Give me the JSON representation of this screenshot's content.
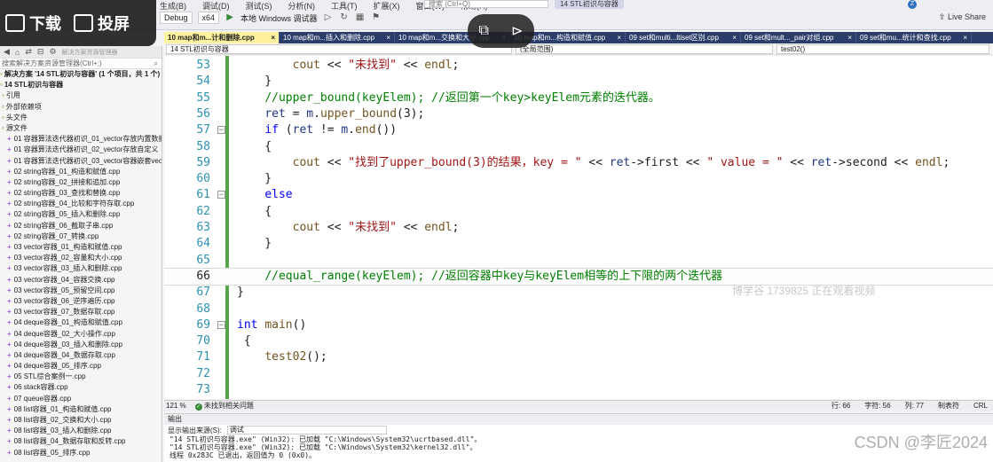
{
  "overlay": {
    "download_label": "下载",
    "share_label": "投屏"
  },
  "menu": {
    "items": [
      "生成(B)",
      "调试(D)",
      "测试(S)",
      "分析(N)",
      "工具(T)",
      "扩展(X)",
      "窗口(W)",
      "帮助(H)"
    ],
    "search_placeholder": "搜索 (Ctrl+Q)",
    "window_title": "14 STL初识与容器",
    "live_share": "Live Share",
    "user_initial": "Z"
  },
  "toolbar": {
    "config": "Debug",
    "platform": "x64",
    "run_label": "本地 Windows 调试器"
  },
  "solution_explorer": {
    "toolbar_label": "解决方案资源管理器",
    "search_placeholder": "搜索解决方案资源管理器(Ctrl+;)",
    "items": [
      {
        "text": "解决方案 '14 STL初识与容器' (1 个项目，共 1 个)",
        "lvl": 0,
        "cpp": false
      },
      {
        "text": "14 STL初识与容器",
        "lvl": 0,
        "cpp": false
      },
      {
        "text": "引用",
        "lvl": 1,
        "cpp": false
      },
      {
        "text": "外部依赖项",
        "lvl": 1,
        "cpp": false
      },
      {
        "text": "头文件",
        "lvl": 1,
        "cpp": false
      },
      {
        "text": "源文件",
        "lvl": 1,
        "cpp": false
      },
      {
        "text": "01 容器算法迭代器初识_01_vector存放内置数据",
        "lvl": 2,
        "cpp": true
      },
      {
        "text": "01 容器算法迭代器初识_02_vector存放自定义",
        "lvl": 2,
        "cpp": true
      },
      {
        "text": "01 容器算法迭代器初识_03_vector容器嵌套vector",
        "lvl": 2,
        "cpp": true
      },
      {
        "text": "02 string容器_01_构造和赋值.cpp",
        "lvl": 2,
        "cpp": true
      },
      {
        "text": "02 string容器_02_拼接和追加.cpp",
        "lvl": 2,
        "cpp": true
      },
      {
        "text": "02 string容器_03_查找和替换.cpp",
        "lvl": 2,
        "cpp": true
      },
      {
        "text": "02 string容器_04_比较和字符存取.cpp",
        "lvl": 2,
        "cpp": true
      },
      {
        "text": "02 string容器_05_插入和删除.cpp",
        "lvl": 2,
        "cpp": true
      },
      {
        "text": "02 string容器_06_截取子串.cpp",
        "lvl": 2,
        "cpp": true
      },
      {
        "text": "02 string容器_07_转换.cpp",
        "lvl": 2,
        "cpp": true
      },
      {
        "text": "03 vector容器_01_构造和赋值.cpp",
        "lvl": 2,
        "cpp": true
      },
      {
        "text": "03 vector容器_02_容量和大小.cpp",
        "lvl": 2,
        "cpp": true
      },
      {
        "text": "03 vector容器_03_插入和删除.cpp",
        "lvl": 2,
        "cpp": true
      },
      {
        "text": "03 vector容器_04_容器交换.cpp",
        "lvl": 2,
        "cpp": true
      },
      {
        "text": "03 vector容器_05_预留空间.cpp",
        "lvl": 2,
        "cpp": true
      },
      {
        "text": "03 vector容器_06_逆序遍历.cpp",
        "lvl": 2,
        "cpp": true
      },
      {
        "text": "03 vector容器_07_数据存取.cpp",
        "lvl": 2,
        "cpp": true
      },
      {
        "text": "04 deque容器_01_构造和赋值.cpp",
        "lvl": 2,
        "cpp": true
      },
      {
        "text": "04 deque容器_02_大小操作.cpp",
        "lvl": 2,
        "cpp": true
      },
      {
        "text": "04 deque容器_03_插入和删除.cpp",
        "lvl": 2,
        "cpp": true
      },
      {
        "text": "04 deque容器_04_数据存取.cpp",
        "lvl": 2,
        "cpp": true
      },
      {
        "text": "04 deque容器_05_排序.cpp",
        "lvl": 2,
        "cpp": true
      },
      {
        "text": "05 STL综合案例一.cpp",
        "lvl": 2,
        "cpp": true
      },
      {
        "text": "06 stack容器.cpp",
        "lvl": 2,
        "cpp": true
      },
      {
        "text": "07 queue容器.cpp",
        "lvl": 2,
        "cpp": true
      },
      {
        "text": "08 list容器_01_构造和赋值.cpp",
        "lvl": 2,
        "cpp": true
      },
      {
        "text": "08 list容器_02_交换和大小.cpp",
        "lvl": 2,
        "cpp": true
      },
      {
        "text": "08 list容器_03_插入和删除.cpp",
        "lvl": 2,
        "cpp": true
      },
      {
        "text": "08 list容器_04_数据存取和反转.cpp",
        "lvl": 2,
        "cpp": true
      },
      {
        "text": "08 list容器_05_排序.cpp",
        "lvl": 2,
        "cpp": true
      }
    ]
  },
  "tabs": [
    {
      "label": "10 map和m...计和删除.cpp",
      "active": true
    },
    {
      "label": "10 map和m...插入和删除.cpp",
      "active": false
    },
    {
      "label": "10 map和m...交换和大小.cpp",
      "active": false
    },
    {
      "label": "10 map和m...构造和赋值.cpp",
      "active": false
    },
    {
      "label": "09 set和multi...ltiset区别.cpp",
      "active": false
    },
    {
      "label": "09 set和mult..._pair对组.cpp",
      "active": false
    },
    {
      "label": "09 set和mu...统计和查找.cpp",
      "active": false
    }
  ],
  "navbar": {
    "project": "14 STL初识与容器",
    "scope": "(全局范围)",
    "function": "test02()"
  },
  "code_lines": [
    {
      "num": "53",
      "fold": "",
      "html": "        <span class='tk-fn'>cout</span> &lt;&lt; <span class='tk-str'>\"未找到\"</span> &lt;&lt; <span class='tk-fn'>endl</span>;"
    },
    {
      "num": "54",
      "fold": "",
      "html": "    }"
    },
    {
      "num": "55",
      "fold": "",
      "html": "    <span class='tk-cm'>//upper_bound(keyElem); //返回第一个key&gt;keyElem元素的迭代器。</span>"
    },
    {
      "num": "56",
      "fold": "",
      "html": "    <span class='tk-var'>ret</span> = <span class='tk-var'>m</span>.<span class='tk-fn'>upper_bound</span>(3);"
    },
    {
      "num": "57",
      "fold": "-",
      "html": "    <span class='tk-kw'>if</span> (<span class='tk-var'>ret</span> != <span class='tk-var'>m</span>.<span class='tk-fn'>end</span>())"
    },
    {
      "num": "58",
      "fold": "",
      "html": "    {"
    },
    {
      "num": "59",
      "fold": "",
      "html": "        <span class='tk-fn'>cout</span> &lt;&lt; <span class='tk-str'>\"找到了upper_bound(3)的结果，key = \"</span> &lt;&lt; <span class='tk-var'>ret</span>-&gt;first &lt;&lt; <span class='tk-str'>\" value = \"</span> &lt;&lt; <span class='tk-var'>ret</span>-&gt;second &lt;&lt; <span class='tk-fn'>endl</span>;"
    },
    {
      "num": "60",
      "fold": "",
      "html": "    }"
    },
    {
      "num": "61",
      "fold": "-",
      "html": "    <span class='tk-kw'>else</span>"
    },
    {
      "num": "62",
      "fold": "",
      "html": "    {"
    },
    {
      "num": "63",
      "fold": "",
      "html": "        <span class='tk-fn'>cout</span> &lt;&lt; <span class='tk-str'>\"未找到\"</span> &lt;&lt; <span class='tk-fn'>endl</span>;"
    },
    {
      "num": "64",
      "fold": "",
      "html": "    }"
    },
    {
      "num": "65",
      "fold": "",
      "html": ""
    },
    {
      "num": "66",
      "fold": "",
      "html": "    <span class='tk-cm'>//equal_range(keyElem); //返回容器中key与keyElem相等的上下限的两个迭代器</span>",
      "current": true
    },
    {
      "num": "67",
      "fold": "",
      "html": "}"
    },
    {
      "num": "68",
      "fold": "",
      "html": ""
    },
    {
      "num": "69",
      "fold": "-",
      "html": "<span class='tk-kw'>int</span> <span class='tk-fn'>main</span>()"
    },
    {
      "num": "70",
      "fold": "",
      "html": " {"
    },
    {
      "num": "71",
      "fold": "",
      "html": "    <span class='tk-fn'>test02</span>();"
    },
    {
      "num": "72",
      "fold": "",
      "html": ""
    },
    {
      "num": "73",
      "fold": "",
      "html": ""
    }
  ],
  "editor_watermark": "博学谷 1739825 正在观看视频",
  "editor_status": {
    "zoom": "121 %",
    "issues": "未找到相关问题",
    "line": "行: 66",
    "char": "字符: 56",
    "col": "列: 77",
    "tabs": "制表符",
    "eol": "CRL"
  },
  "output": {
    "title": "输出",
    "source_label": "显示输出来源(S):",
    "source_value": "调试",
    "lines": [
      "\"14 STL初识与容器.exe\" (Win32): 已加载 \"C:\\Windows\\System32\\ucrtbased.dll\"。",
      "\"14 STL初识与容器.exe\" (Win32): 已加载 \"C:\\Windows\\System32\\kernel32.dll\"。",
      "线程 0x283C 已退出，返回值为 0 (0x0)。"
    ]
  },
  "csdn_watermark": "CSDN @李匠2024"
}
